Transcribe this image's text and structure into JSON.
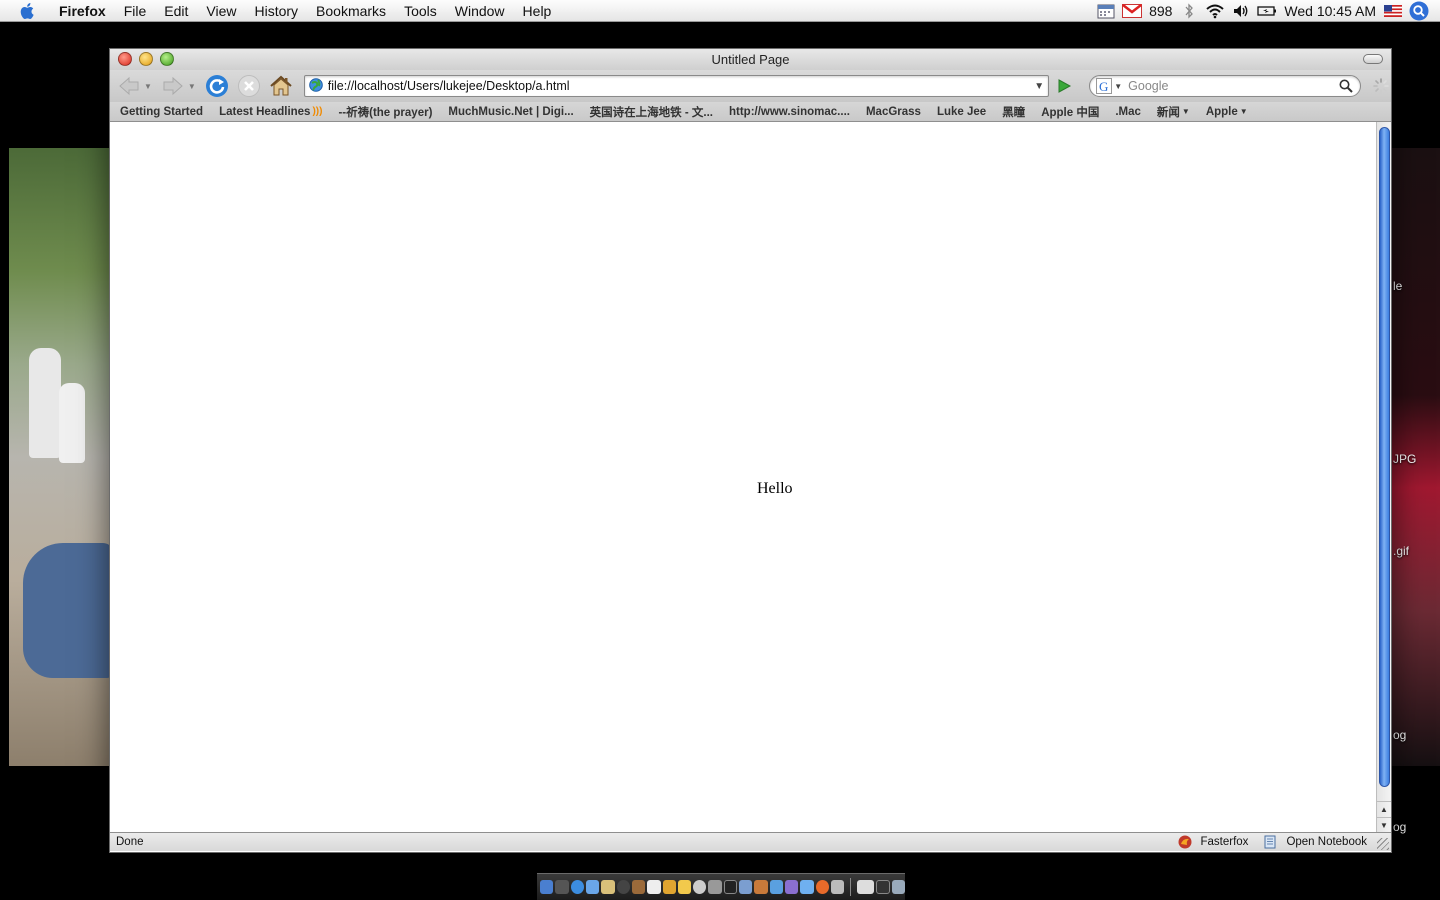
{
  "menubar": {
    "app_name": "Firefox",
    "menus": [
      "File",
      "Edit",
      "View",
      "History",
      "Bookmarks",
      "Tools",
      "Window",
      "Help"
    ],
    "mail_count": "898",
    "clock": "Wed 10:45 AM"
  },
  "desktop": {
    "labels": [
      "le",
      "JPG",
      ".gif",
      "og",
      "og"
    ]
  },
  "window": {
    "title": "Untitled Page",
    "url": "file://localhost/Users/lukejee/Desktop/a.html",
    "search_placeholder": "Google",
    "bookmarks": [
      {
        "label": "Getting Started"
      },
      {
        "label": "Latest Headlines",
        "rss": true
      },
      {
        "label": "--祈祷(the prayer)"
      },
      {
        "label": "MuchMusic.Net | Digi..."
      },
      {
        "label": "英国诗在上海地铁 - 文..."
      },
      {
        "label": "http://www.sinomac...."
      },
      {
        "label": "MacGrass"
      },
      {
        "label": "Luke Jee"
      },
      {
        "label": "黑瞳"
      },
      {
        "label": "Apple 中国"
      },
      {
        "label": ".Mac"
      },
      {
        "label": "新闻",
        "folder": true
      },
      {
        "label": "Apple",
        "folder": true
      }
    ],
    "page_text": "Hello",
    "status": "Done",
    "status_items": [
      "Fasterfox",
      "Open Notebook"
    ]
  },
  "colors": {
    "scroll_thumb": "#3c7ee0",
    "go_arrow": "#3aa83a",
    "reload": "#2b7fd6"
  }
}
